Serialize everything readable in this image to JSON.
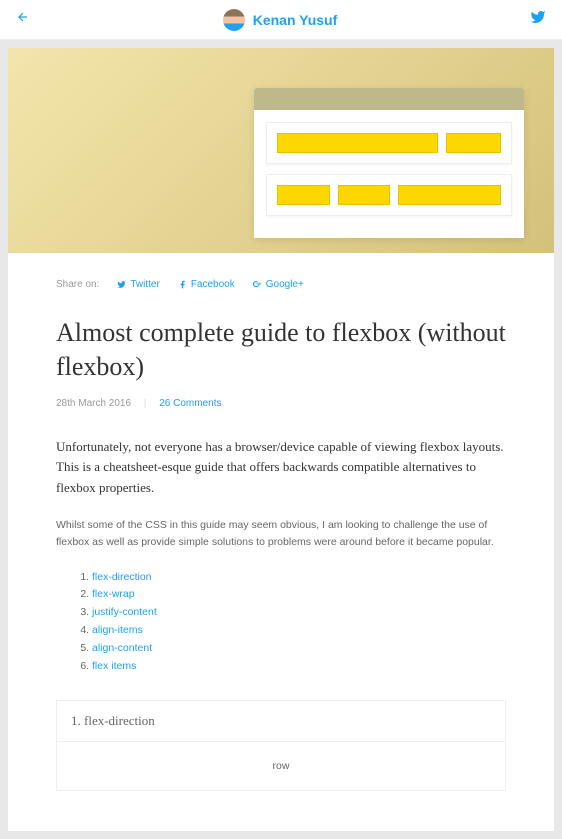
{
  "topbar": {
    "site_name": "Kenan Yusuf"
  },
  "share": {
    "label": "Share on:",
    "twitter": "Twitter",
    "facebook": "Facebook",
    "google": "Google+"
  },
  "article": {
    "title": "Almost complete guide to flexbox (without flexbox)",
    "date": "28th March 2016",
    "comments_label": "26 Comments",
    "intro": "Unfortunately, not everyone has a browser/device capable of viewing flexbox layouts. This is a cheatsheet-esque guide that offers backwards compatible alternatives to flexbox properties.",
    "body": "Whilst some of the CSS in this guide may seem obvious, I am looking to challenge the use of flexbox as well as provide simple solutions to problems were around before it became popular."
  },
  "toc": [
    "flex-direction",
    "flex-wrap",
    "justify-content",
    "align-items",
    "align-content",
    "flex items"
  ],
  "section1": {
    "heading": "1. flex-direction",
    "row_label": "row"
  }
}
